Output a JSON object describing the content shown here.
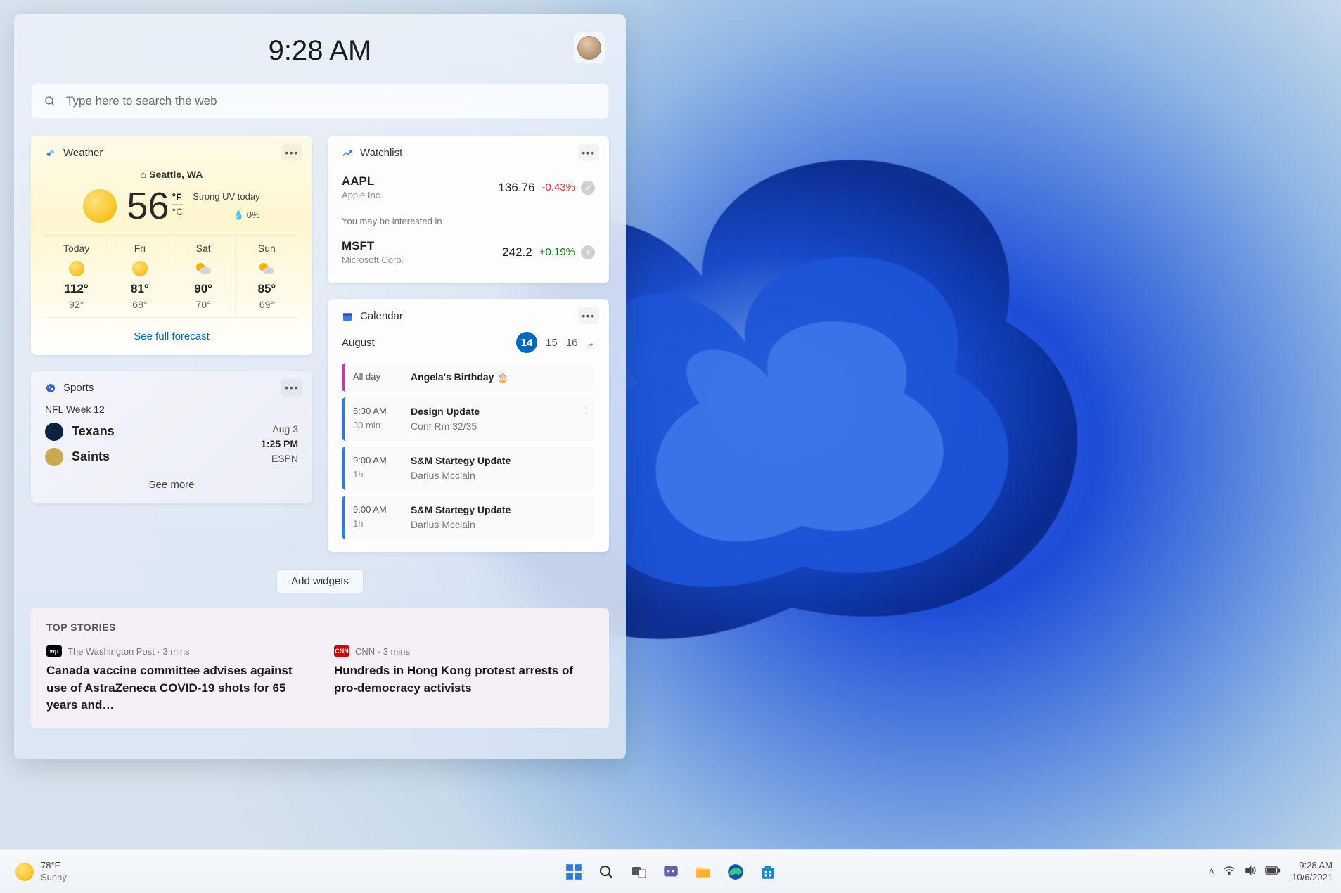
{
  "panel": {
    "time": "9:28 AM",
    "search_placeholder": "Type here to search the web"
  },
  "weather": {
    "title": "Weather",
    "location": "Seattle, WA",
    "temp": "56",
    "unit_f": "°F",
    "unit_c": "°C",
    "cond1": "Strong UV today",
    "cond2_icon": "💧",
    "cond2": "0%",
    "days": [
      {
        "d": "Today",
        "hi": "112°",
        "lo": "92°",
        "icon": "sun"
      },
      {
        "d": "Fri",
        "hi": "81°",
        "lo": "68°",
        "icon": "sun"
      },
      {
        "d": "Sat",
        "hi": "90°",
        "lo": "70°",
        "icon": "part"
      },
      {
        "d": "Sun",
        "hi": "85°",
        "lo": "69°",
        "icon": "part"
      }
    ],
    "link": "See full forecast"
  },
  "watchlist": {
    "title": "Watchlist",
    "rows": [
      {
        "sym": "AAPL",
        "name": "Apple Inc.",
        "price": "136.76",
        "chg": "-0.43%",
        "dir": "neg",
        "badge": "✓"
      },
      {
        "sym": "MSFT",
        "name": "Microsoft Corp.",
        "price": "242.2",
        "chg": "+0.19%",
        "dir": "pos",
        "badge": "+"
      }
    ],
    "note": "You may be interested in"
  },
  "calendar": {
    "title": "Calendar",
    "month": "August",
    "dates": [
      "14",
      "15",
      "16"
    ],
    "selected": "14",
    "events": [
      {
        "color": "magenta",
        "time": "All day",
        "dur": "",
        "title": "Angela's Birthday 🎂",
        "sub": ""
      },
      {
        "color": "blue",
        "time": "8:30 AM",
        "dur": "30 min",
        "title": "Design Update",
        "sub": "Conf Rm 32/35",
        "handle": true
      },
      {
        "color": "blue",
        "time": "9:00 AM",
        "dur": "1h",
        "title": "S&M Startegy Update",
        "sub": "Darius Mcclain"
      },
      {
        "color": "blue",
        "time": "9:00 AM",
        "dur": "1h",
        "title": "S&M Startegy Update",
        "sub": "Darius Mcclain"
      }
    ]
  },
  "sports": {
    "title": "Sports",
    "subtitle": "NFL Week 12",
    "teams": [
      {
        "name": "Texans",
        "color": "#0b2340"
      },
      {
        "name": "Saints",
        "color": "#c8a951"
      }
    ],
    "date": "Aug 3",
    "time": "1:25 PM",
    "channel": "ESPN",
    "link": "See more"
  },
  "add_widgets": "Add widgets",
  "news": {
    "heading": "TOP STORIES",
    "stories": [
      {
        "badge": "wp",
        "badge_bg": "#000",
        "src": "The Washington Post",
        "ago": "3 mins",
        "head": "Canada vaccine committee advises against use of AstraZeneca COVID-19 shots for 65 years and…"
      },
      {
        "badge": "CNN",
        "badge_bg": "#cc0000",
        "src": "CNN",
        "ago": "3 mins",
        "head": "Hundreds in Hong Kong protest arrests of pro-democracy activists"
      }
    ]
  },
  "taskbar": {
    "temp": "78°F",
    "cond": "Sunny",
    "time": "9:28 AM",
    "date": "10/6/2021"
  }
}
